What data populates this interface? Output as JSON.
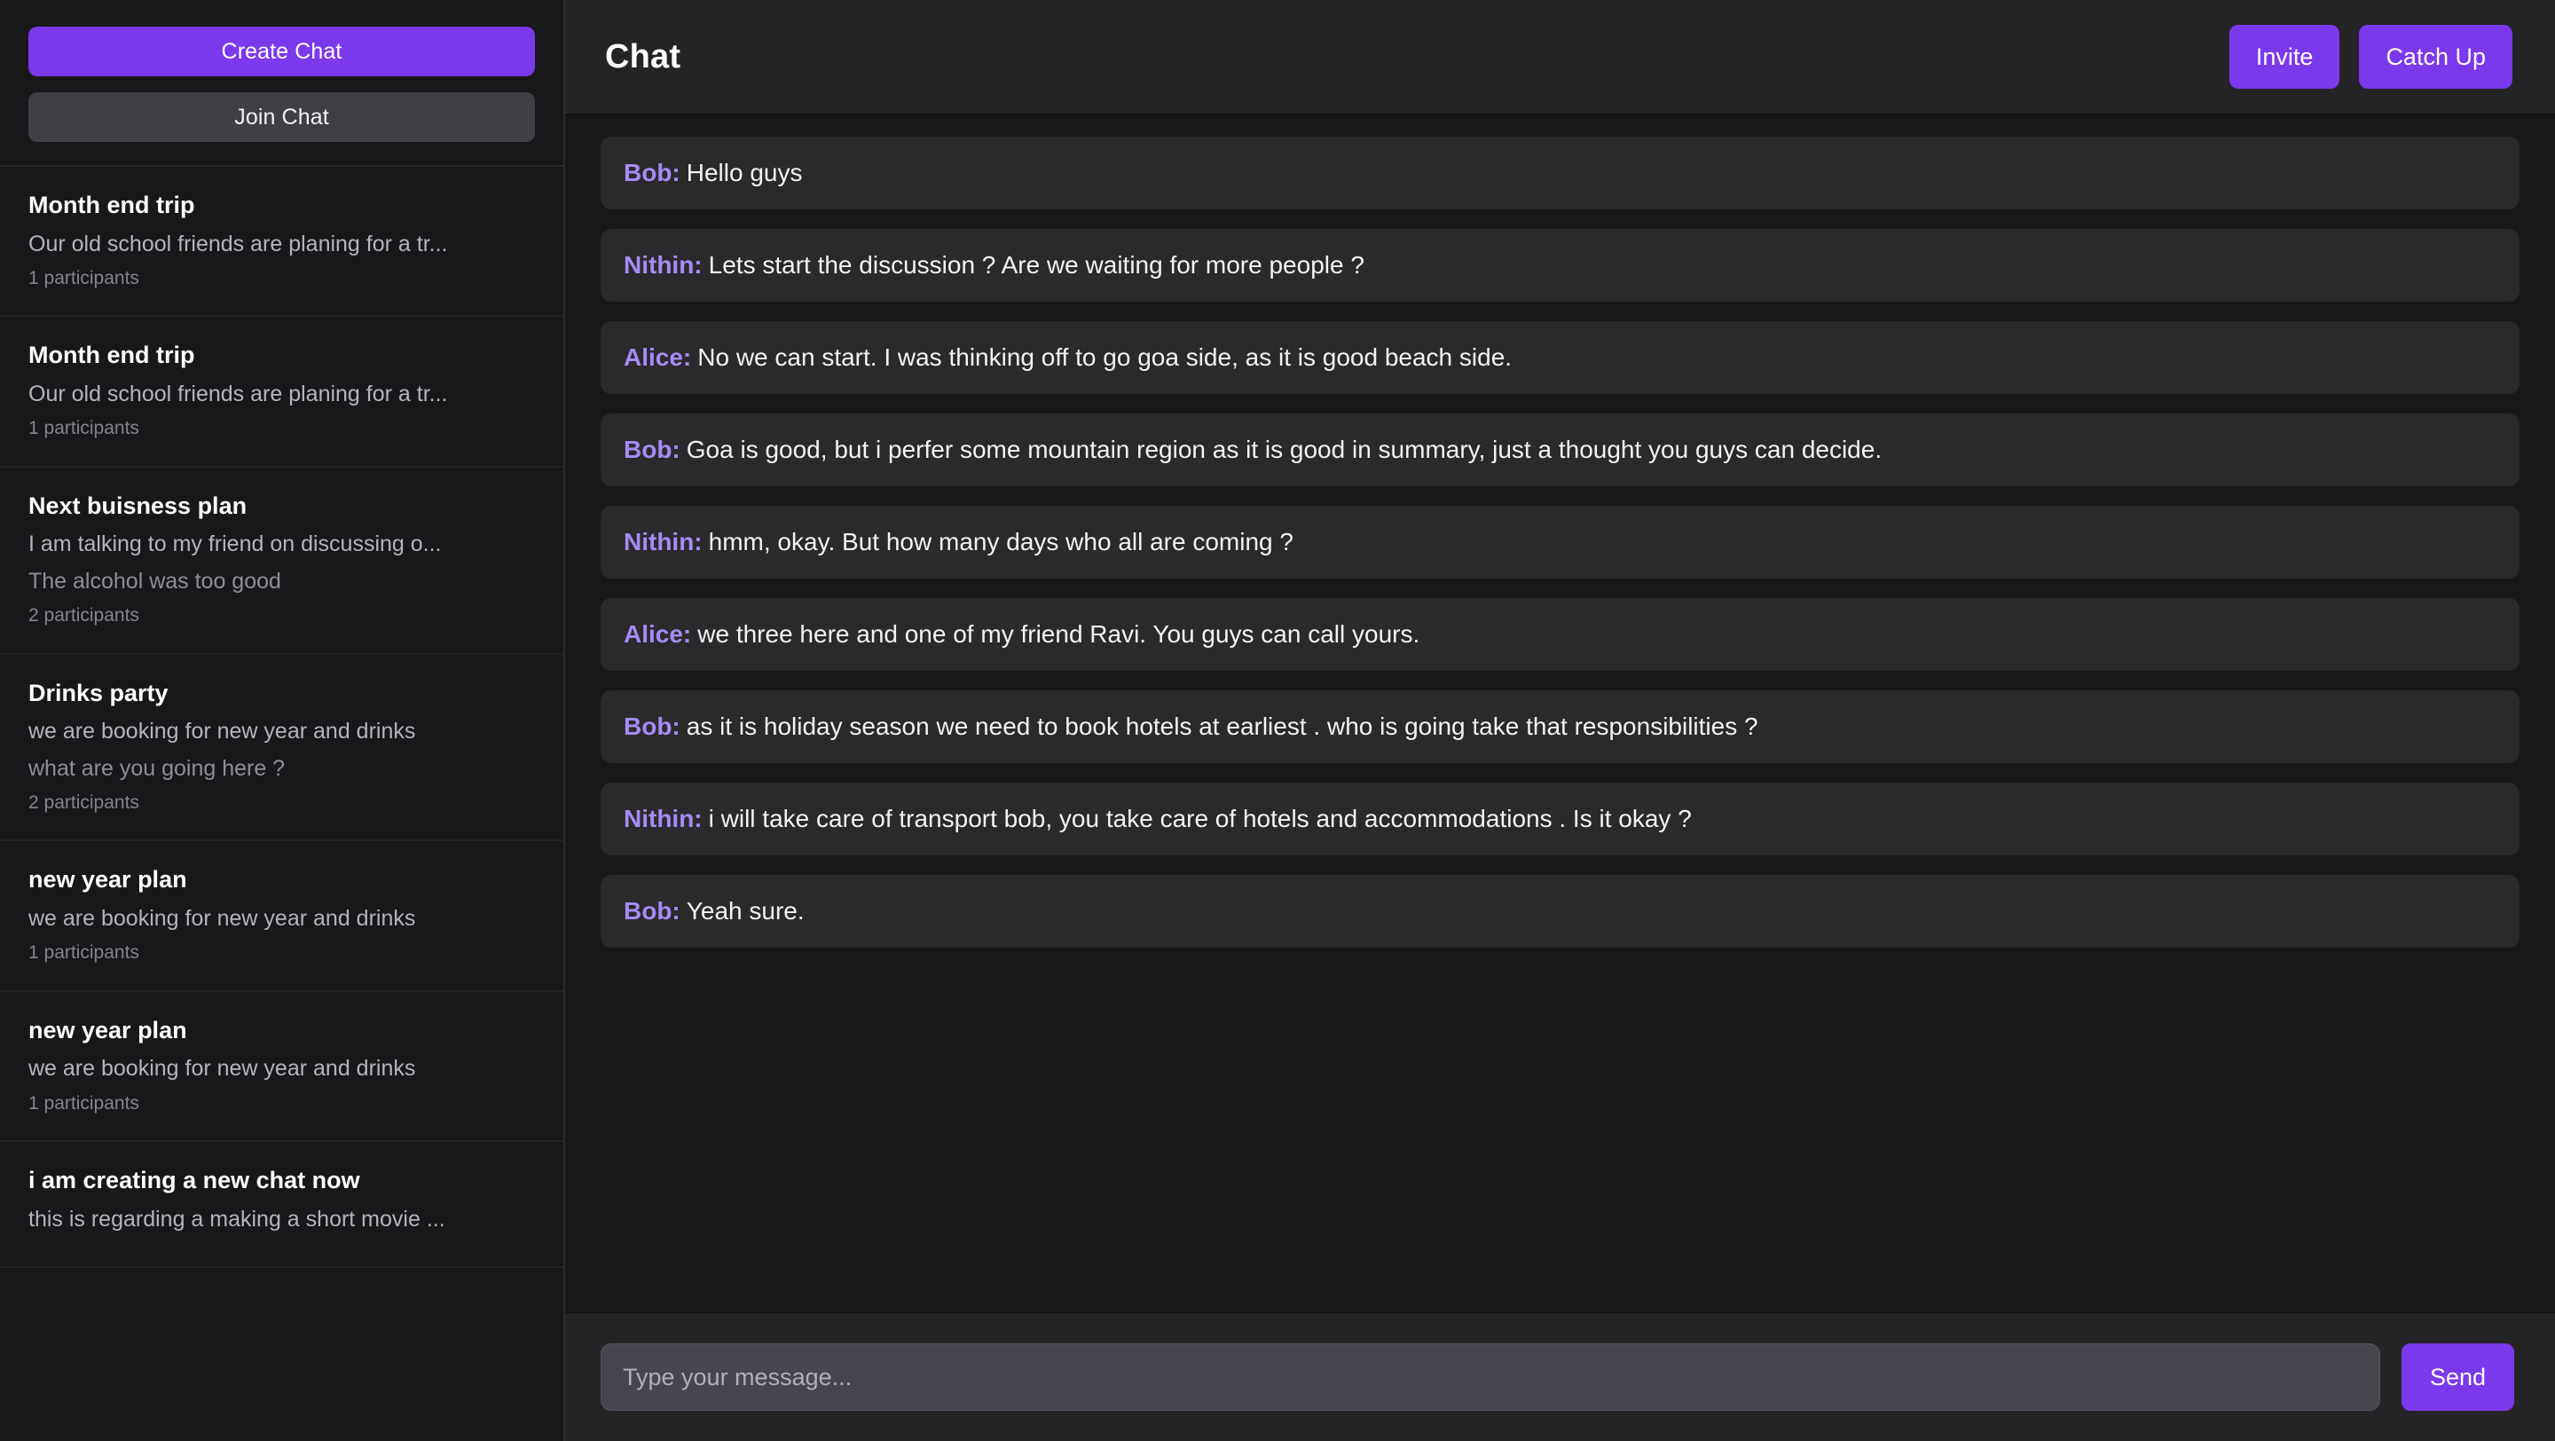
{
  "sidebar": {
    "create_chat_label": "Create Chat",
    "join_chat_label": "Join Chat",
    "chats": [
      {
        "title": "Month end trip",
        "description": "Our old school friends are planing for a tr...",
        "last_message": "",
        "participants": "1 participants"
      },
      {
        "title": "Month end trip",
        "description": "Our old school friends are planing for a tr...",
        "last_message": "",
        "participants": "1 participants"
      },
      {
        "title": "Next buisness plan",
        "description": "I am talking to my friend on discussing o...",
        "last_message": "The alcohol was too good",
        "participants": "2 participants"
      },
      {
        "title": "Drinks party",
        "description": "we are booking for new year and drinks",
        "last_message": "what are you going here ?",
        "participants": "2 participants"
      },
      {
        "title": "new year plan",
        "description": "we are booking for new year and drinks",
        "last_message": "",
        "participants": "1 participants"
      },
      {
        "title": "new year plan",
        "description": "we are booking for new year and drinks",
        "last_message": "",
        "participants": "1 participants"
      },
      {
        "title": "i am creating a new chat now",
        "description": "this is regarding a making a short movie ...",
        "last_message": "",
        "participants": ""
      }
    ]
  },
  "header": {
    "title": "Chat",
    "invite_label": "Invite",
    "catch_up_label": "Catch Up"
  },
  "messages": [
    {
      "sender": "Bob:",
      "text": "Hello guys"
    },
    {
      "sender": "Nithin:",
      "text": "Lets start the discussion ? Are we waiting for more people ?"
    },
    {
      "sender": "Alice:",
      "text": "No we can start. I was thinking off to go goa side, as it is good beach side."
    },
    {
      "sender": "Bob:",
      "text": "Goa is good, but i perfer some mountain region as it is good in summary, just a thought you guys can decide."
    },
    {
      "sender": "Nithin:",
      "text": "hmm, okay. But how many days who all are coming ?"
    },
    {
      "sender": "Alice:",
      "text": "we three here and one of my friend Ravi. You guys can call yours."
    },
    {
      "sender": "Bob:",
      "text": "as it is holiday season we need to book hotels at earliest . who is going take that responsibilities ?"
    },
    {
      "sender": "Nithin:",
      "text": "i will take care of transport bob, you take care of hotels and accommodations . Is it okay ?"
    },
    {
      "sender": "Bob:",
      "text": "Yeah sure."
    }
  ],
  "composer": {
    "placeholder": "Type your message...",
    "value": "",
    "send_label": "Send"
  },
  "colors": {
    "accent": "#7c38eb",
    "sender": "#a58bf5",
    "sidebar_bg": "#18181a",
    "chat_bg": "#181818",
    "bubble_bg": "#2a2a2c",
    "header_bg": "#242426",
    "secondary_button": "#3f3f46"
  }
}
